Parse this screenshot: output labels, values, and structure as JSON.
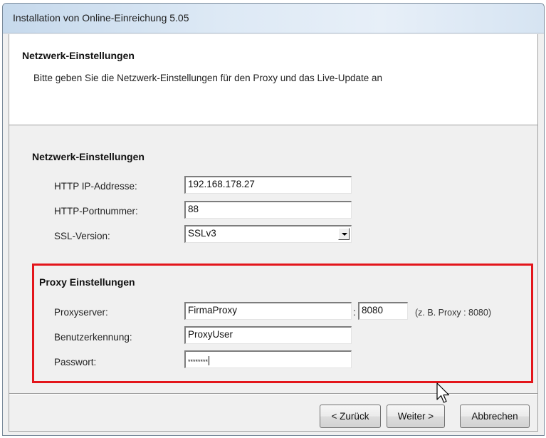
{
  "window": {
    "title": "Installation von Online-Einreichung 5.05"
  },
  "header": {
    "title": "Netzwerk-Einstellungen",
    "subtitle": "Bitte geben Sie die Netzwerk-Einstellungen für den Proxy und das Live-Update an"
  },
  "network": {
    "section_title": "Netzwerk-Einstellungen",
    "ip_label": "HTTP IP-Addresse:",
    "ip_value": "192.168.178.27",
    "port_label": "HTTP-Portnummer:",
    "port_value": "88",
    "ssl_label": "SSL-Version:",
    "ssl_value": "SSLv3"
  },
  "proxy": {
    "section_title": "Proxy Einstellungen",
    "server_label": "Proxyserver:",
    "server_value": "FirmaProxy",
    "colon": ":",
    "port_value": "8080",
    "hint": "(z. B. Proxy : 8080)",
    "user_label": "Benutzerkennung:",
    "user_value": "ProxyUser",
    "password_label": "Passwort:",
    "password_value": "********",
    "highlight_color": "#e3151b"
  },
  "buttons": {
    "back": "< Zurück",
    "next": "Weiter >",
    "cancel": "Abbrechen"
  },
  "icons": {
    "cursor": "arrow-cursor-icon"
  }
}
